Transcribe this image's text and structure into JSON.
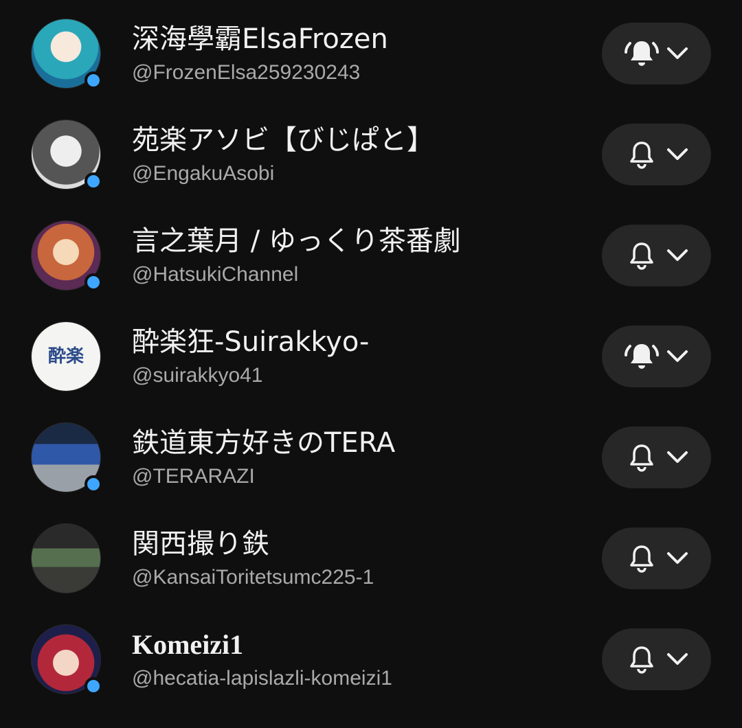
{
  "channels": [
    {
      "name": "深海學霸ElsaFrozen",
      "handle": "@FrozenElsa259230243",
      "bell": "bell-all-icon",
      "avatar_color": "#2aa7b8",
      "avatar_glyph": ""
    },
    {
      "name": "苑楽アソビ【びじぱと】",
      "handle": "@EngakuAsobi",
      "bell": "bell-outline-icon",
      "avatar_color": "#8a8a8a",
      "avatar_glyph": ""
    },
    {
      "name": "言之葉月 / ゆっくり茶番劇",
      "handle": "@HatsukiChannel",
      "bell": "bell-outline-icon",
      "avatar_color": "#b8583c",
      "avatar_glyph": ""
    },
    {
      "name": "酔楽狂-Suirakkyo-",
      "handle": "@suirakkyo41",
      "bell": "bell-all-icon",
      "avatar_color": "#f4f4f2",
      "avatar_glyph": "酔楽"
    },
    {
      "name": "鉄道東方好きのTERA",
      "handle": "@TERARAZI",
      "bell": "bell-outline-icon",
      "avatar_color": "#2f4f86",
      "avatar_glyph": ""
    },
    {
      "name": "関西撮り鉄",
      "handle": "@KansaiToritetsumc225-1",
      "bell": "bell-outline-icon",
      "avatar_color": "#3d4a3b",
      "avatar_glyph": ""
    },
    {
      "name": "Komeizi1",
      "handle": "@hecatia-lapislazli-komeizi1",
      "bell": "bell-outline-icon",
      "avatar_color": "#7a1f2b",
      "avatar_glyph": ""
    }
  ],
  "colors": {
    "background": "#0f0f0f",
    "button_bg": "#272727",
    "live_dot": "#3ea6ff",
    "handle_text": "#aaaaaa"
  }
}
